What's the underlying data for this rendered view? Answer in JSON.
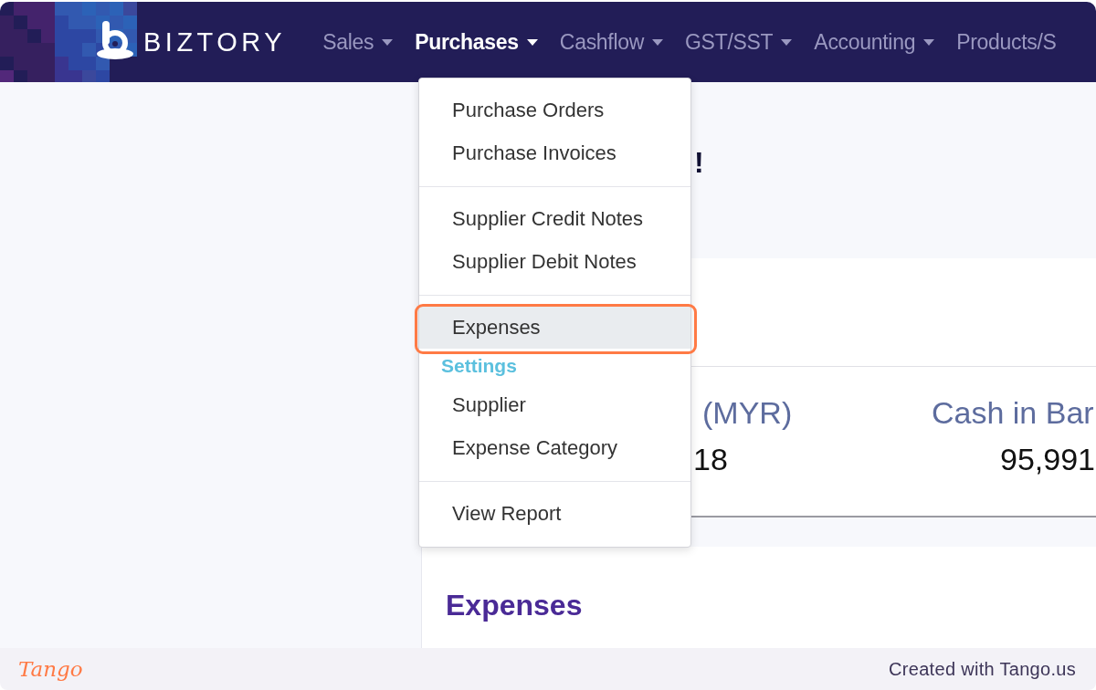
{
  "navbar": {
    "brand": "BIZTORY",
    "items": [
      {
        "label": "Sales",
        "selected": false,
        "caret": true
      },
      {
        "label": "Purchases",
        "selected": true,
        "caret": true
      },
      {
        "label": "Cashflow",
        "selected": false,
        "caret": true
      },
      {
        "label": "GST/SST",
        "selected": false,
        "caret": true
      },
      {
        "label": "Accounting",
        "selected": false,
        "caret": true
      },
      {
        "label": "Products/S",
        "selected": false,
        "caret": false
      }
    ]
  },
  "dropdown": {
    "groups": [
      {
        "items": [
          {
            "kind": "item",
            "label": "Purchase Orders",
            "selected": false
          },
          {
            "kind": "item",
            "label": "Purchase Invoices",
            "selected": false
          }
        ]
      },
      {
        "items": [
          {
            "kind": "item",
            "label": "Supplier Credit Notes",
            "selected": false
          },
          {
            "kind": "item",
            "label": "Supplier Debit Notes",
            "selected": false
          }
        ]
      },
      {
        "items": [
          {
            "kind": "item",
            "label": "Expenses",
            "selected": true
          },
          {
            "kind": "header",
            "label": "Settings"
          },
          {
            "kind": "item",
            "label": "Supplier",
            "selected": false
          },
          {
            "kind": "item",
            "label": "Expense Category",
            "selected": false
          }
        ]
      },
      {
        "items": [
          {
            "kind": "item",
            "label": "View Report",
            "selected": false
          }
        ]
      }
    ]
  },
  "main": {
    "greeting": "!",
    "stats": [
      {
        "label": "(MYR)",
        "value": "18"
      },
      {
        "label": "Cash in Bar",
        "value": "95,991"
      }
    ],
    "section_title": "Expenses"
  },
  "footer": {
    "logo": "Tango",
    "credit": "Created with Tango.us"
  }
}
